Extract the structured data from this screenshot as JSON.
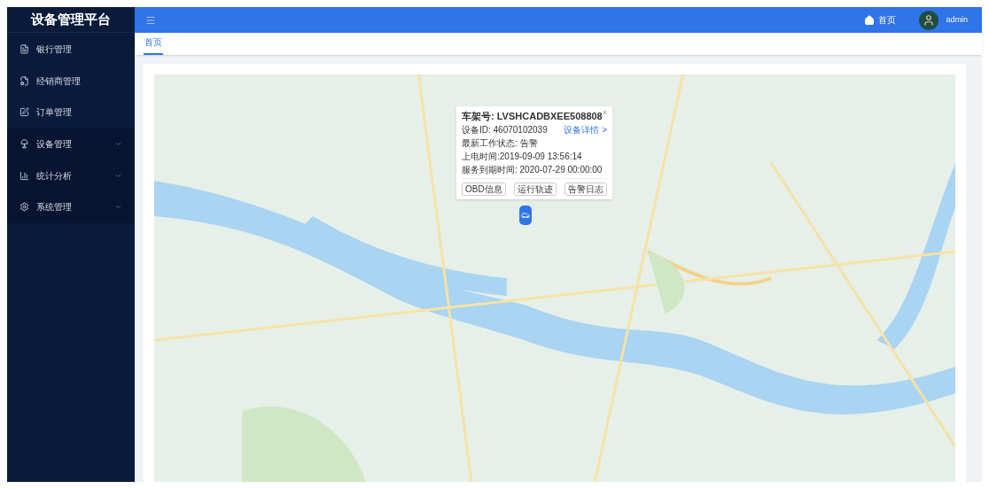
{
  "sidebar": {
    "title": "设备管理平台",
    "items": [
      {
        "label": "银行管理",
        "expandable": false,
        "selected": false
      },
      {
        "label": "经销商管理",
        "expandable": false,
        "selected": false
      },
      {
        "label": "订单管理",
        "expandable": false,
        "selected": false
      },
      {
        "label": "设备管理",
        "expandable": true,
        "selected": false
      },
      {
        "label": "统计分析",
        "expandable": true,
        "selected": false
      },
      {
        "label": "系统管理",
        "expandable": true,
        "selected": false
      }
    ]
  },
  "header": {
    "home": "首页",
    "user": "admin"
  },
  "tabs": [
    {
      "label": "首页",
      "selected": true
    }
  ],
  "popup": {
    "title": "车架号: LVSHCADBXEE508808",
    "close": "×",
    "device_id": "设备ID: 46070102039",
    "detail_link": "设备详情 >",
    "lines": [
      "最新工作状态: 告警",
      "上电时间:2019-09-09 13:56:14",
      "服务到期时间: 2020-07-29 00:00:00"
    ],
    "buttons": [
      "OBD信息",
      "运行轨迹",
      "告警日志"
    ]
  }
}
